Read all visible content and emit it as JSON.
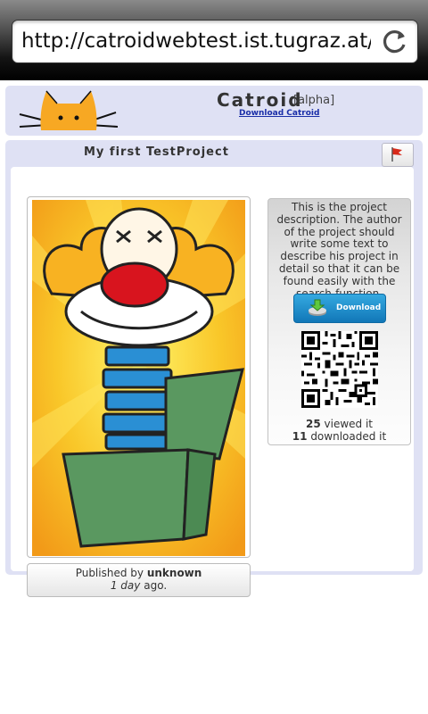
{
  "browser": {
    "url": "http://catroidwebtest.ist.tugraz.at/..."
  },
  "header": {
    "title": "Catroid",
    "tag": "[alpha]",
    "download_link": "Download Catroid"
  },
  "project": {
    "title": "My first TestProject",
    "description": "This is the project description. The author of the project should write some text to describe his project in detail so that it can be found easily with the search-function.",
    "download_label": "Download",
    "views": "25",
    "views_label": "viewed it",
    "downloads": "11",
    "downloads_label": "downloaded it",
    "published_by_label": "Published by",
    "author": "unknown",
    "age": "1 day",
    "age_suffix": "ago."
  },
  "colors": {
    "card_bg": "#dfe1f4",
    "link": "#1a2ea8",
    "button_blue": "#1e8fd0",
    "logo_orange": "#f7a823"
  },
  "icons": {
    "reload": "reload-icon",
    "flag": "flag-icon",
    "download": "download-icon",
    "qr": "qr-code-icon"
  }
}
